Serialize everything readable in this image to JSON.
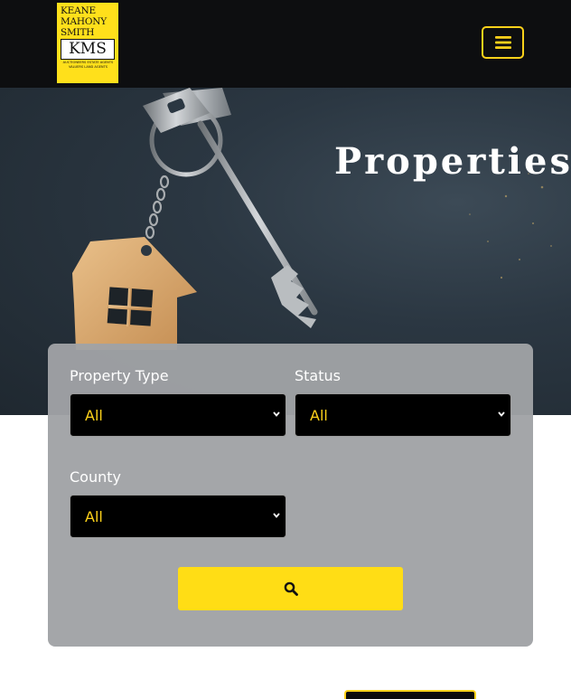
{
  "logo": {
    "lines": [
      "KEANE",
      "MAHONY",
      "SMITH"
    ],
    "mark": "KMS",
    "tagline_1": "AUCTIONEERS  ESTATE AGENTS",
    "tagline_2": "VALUERS   LAND AGENTS"
  },
  "header": {
    "menu_icon": "hamburger-icon",
    "accent": "#ffd21a"
  },
  "hero": {
    "title": "Properties"
  },
  "filters": {
    "property_type": {
      "label": "Property Type",
      "value": "All"
    },
    "status": {
      "label": "Status",
      "value": "All"
    },
    "county": {
      "label": "County",
      "value": "All"
    },
    "search_icon": "search-icon"
  },
  "colors": {
    "accent_yellow": "#ffdd15",
    "header_bg": "#0d0e10",
    "card_bg": "#a0a2a5"
  }
}
